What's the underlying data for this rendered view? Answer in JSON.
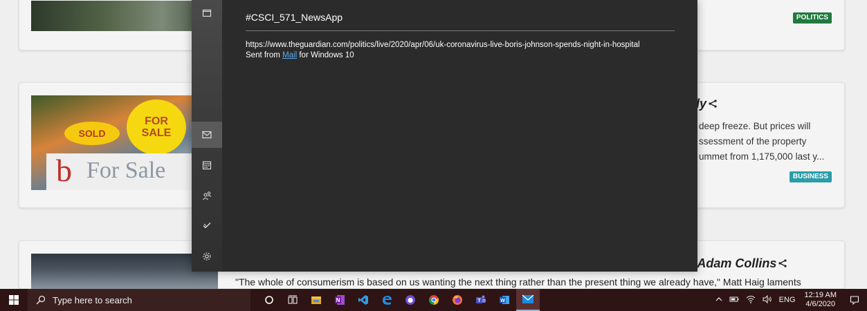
{
  "news": {
    "card1": {
      "badge": "POLITICS"
    },
    "card2": {
      "title_fragment": "ly",
      "description_lines": [
        "deep freeze. But prices will",
        "ssessment of the property",
        "ummet from 1,175,000 last y..."
      ],
      "badge": "BUSINESS",
      "image_signs": {
        "sold": "SOLD",
        "for_sale": "FOR\nSALE",
        "board": "For Sale",
        "board_letter": "b"
      }
    },
    "card3": {
      "title_fragment": "| Adam Collins",
      "quote": "\"The whole of consumerism is based on us wanting the next thing rather than the present thing we already have,\" Matt Haig laments"
    }
  },
  "mail": {
    "subject": "#CSCI_571_NewsApp",
    "body_url": "https://www.theguardian.com/politics/live/2020/apr/06/uk-coronavirus-live-boris-johnson-spends-night-in-hospital",
    "sent_from_prefix": "Sent from ",
    "sent_from_link": "Mail",
    "sent_from_suffix": " for Windows 10",
    "rail_items": [
      {
        "icon": "folder-icon"
      },
      {
        "icon": "mail-icon",
        "active": true
      },
      {
        "icon": "calendar-icon"
      },
      {
        "icon": "people-icon"
      },
      {
        "icon": "todo-icon"
      },
      {
        "icon": "settings-icon"
      }
    ]
  },
  "taskbar": {
    "search_placeholder": "Type here to search",
    "apps": [
      "cortana-icon",
      "task-view-icon",
      "file-explorer-icon",
      "onenote-icon",
      "vscode-icon",
      "edge-icon",
      "app-icon",
      "chrome-icon",
      "firefox-icon",
      "teams-icon",
      "word-icon",
      "mail-icon"
    ],
    "language": "ENG",
    "time": "12:19 AM",
    "date": "4/6/2020"
  },
  "colors": {
    "mail_bg": "#2b2b2b",
    "link": "#5aa9ef",
    "taskbar": "#2e1414",
    "politics_badge": "#1f7a3e",
    "business_badge": "#2a9da8"
  }
}
